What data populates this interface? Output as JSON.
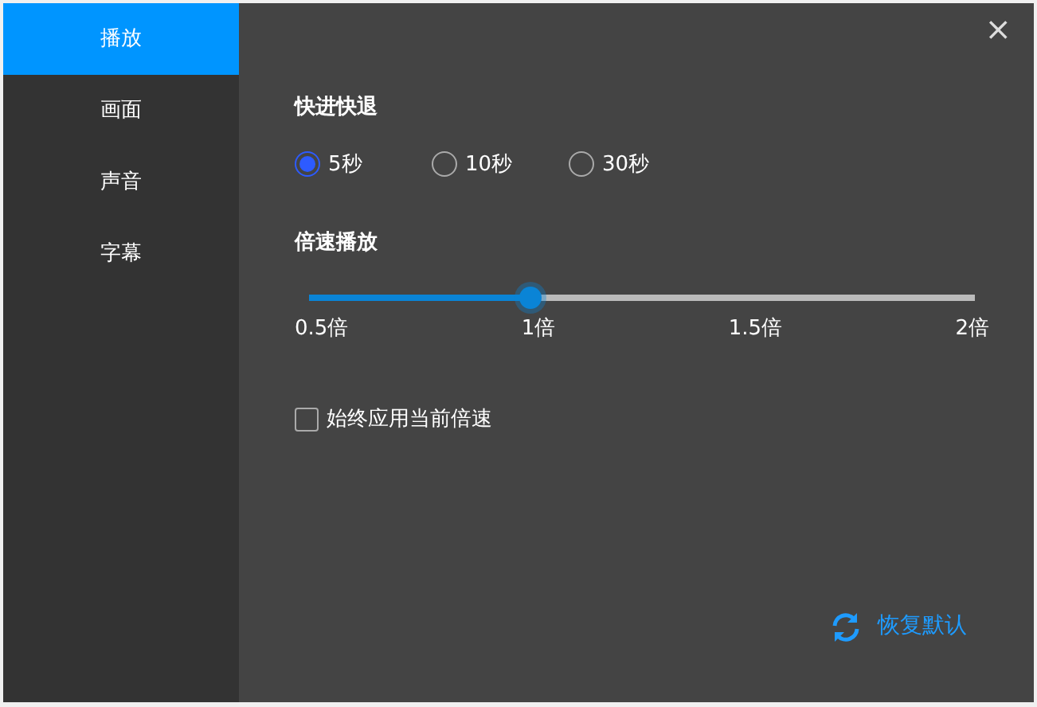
{
  "sidebar": {
    "items": [
      {
        "label": "播放",
        "selected": true
      },
      {
        "label": "画面",
        "selected": false
      },
      {
        "label": "声音",
        "selected": false
      },
      {
        "label": "字幕",
        "selected": false
      }
    ]
  },
  "close": "×",
  "seek": {
    "title": "快进快退",
    "options": [
      {
        "label": "5秒",
        "selected": true
      },
      {
        "label": "10秒",
        "selected": false
      },
      {
        "label": "30秒",
        "selected": false
      }
    ]
  },
  "speed": {
    "title": "倍速播放",
    "level": 0.333,
    "ticks": [
      "0.5倍",
      "1倍",
      "1.5倍",
      "2倍"
    ]
  },
  "always_apply": {
    "label": "始终应用当前倍速",
    "checked": false
  },
  "reset": {
    "label": "恢复默认"
  }
}
